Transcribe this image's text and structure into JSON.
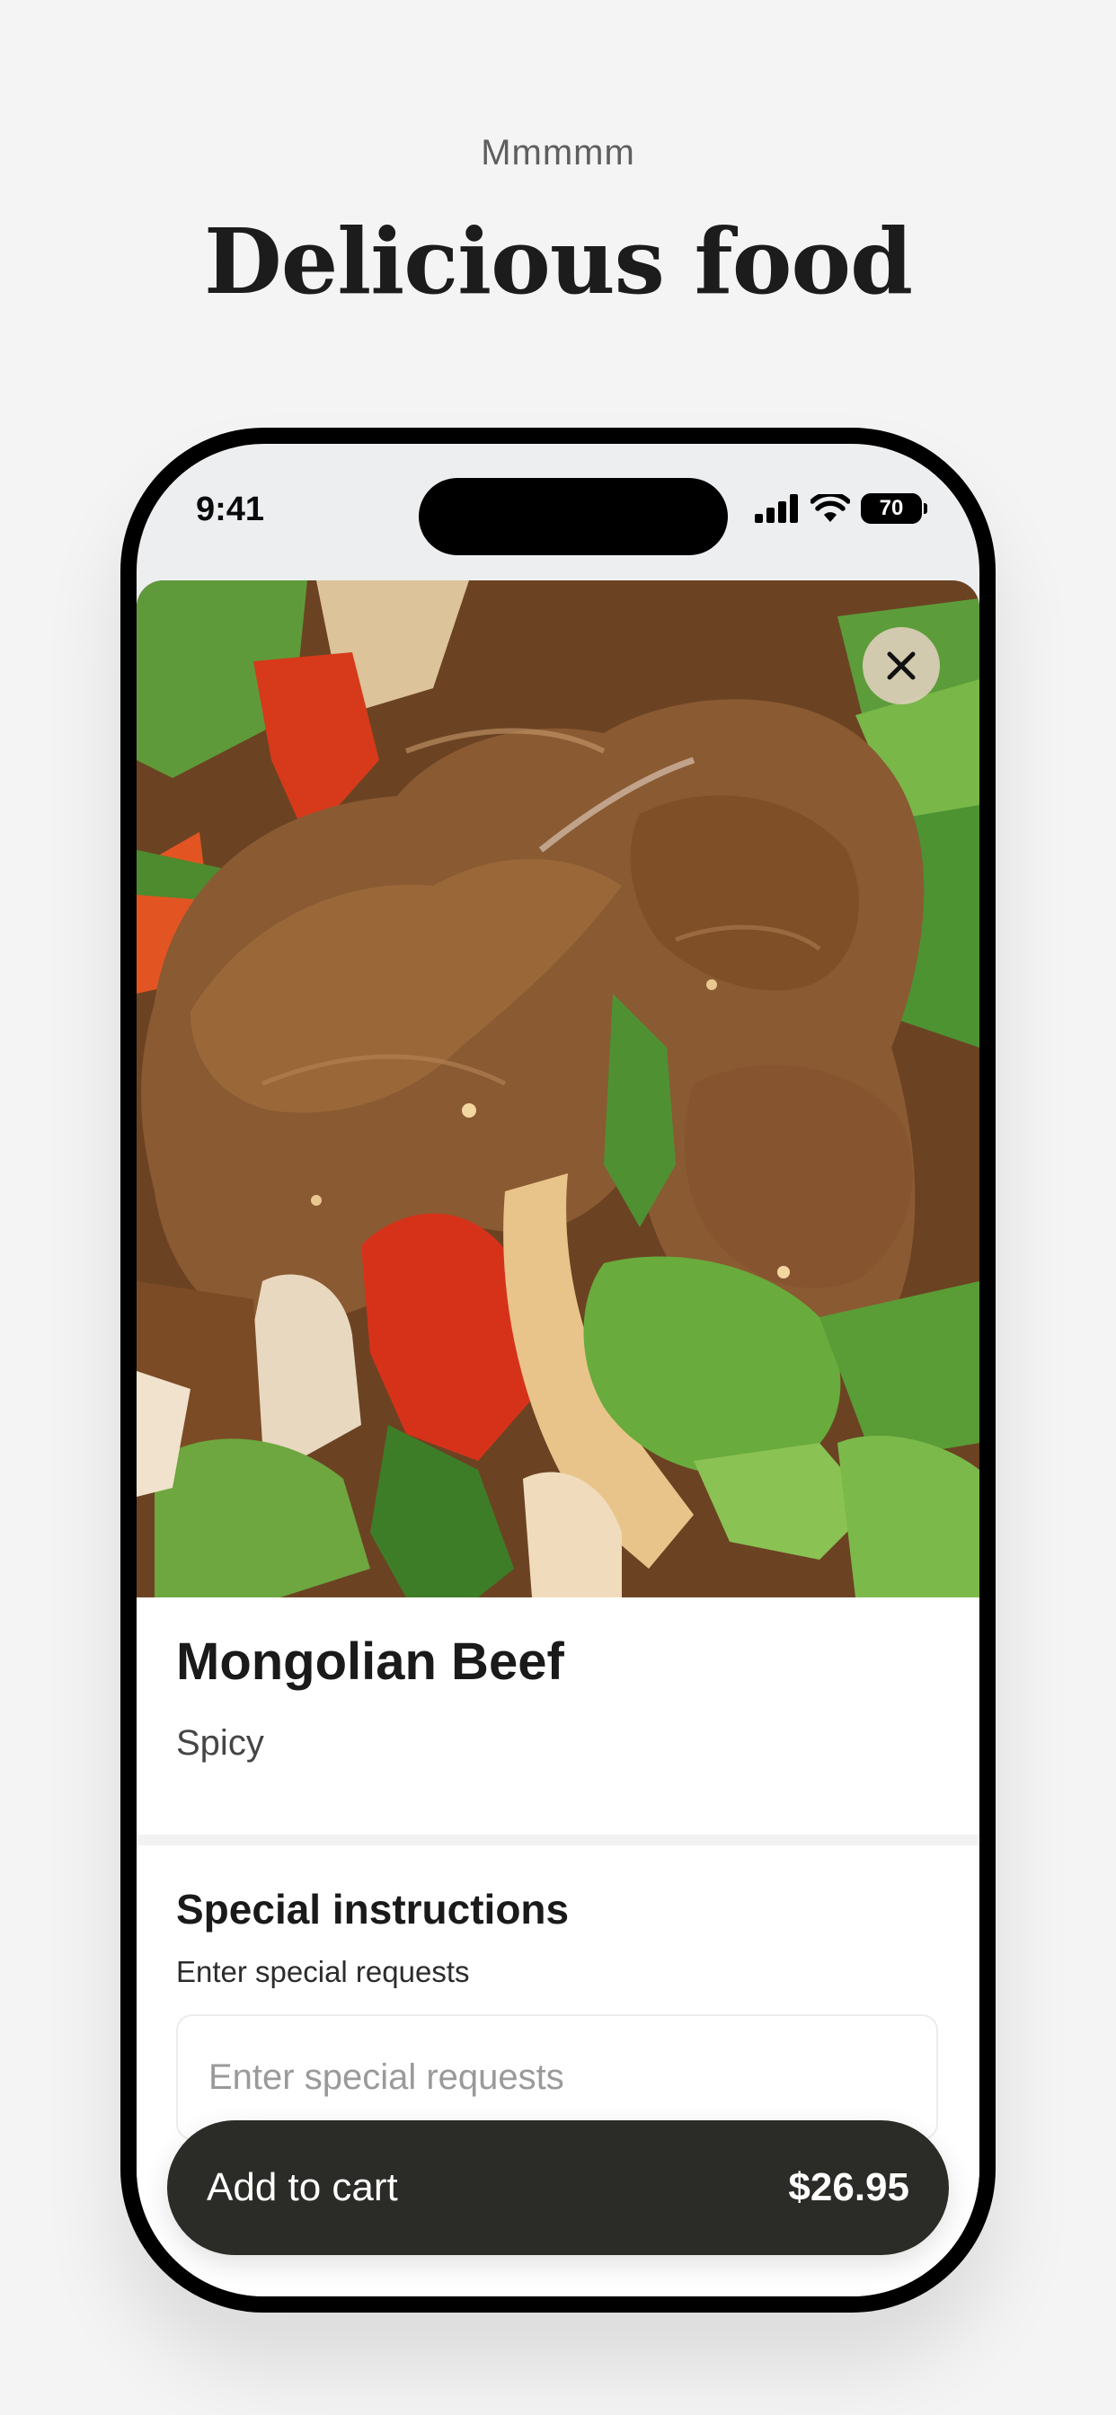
{
  "hero": {
    "kicker": "Mmmmm",
    "headline": "Delicious food"
  },
  "status_bar": {
    "time": "9:41",
    "battery": "70",
    "icons": [
      "cellular-signal-icon",
      "wifi-icon",
      "battery-icon"
    ]
  },
  "item": {
    "photo_subject": "Mongolian beef with peppers and onions",
    "close_icon": "close-icon",
    "name": "Mongolian Beef",
    "description": "Spicy"
  },
  "instructions": {
    "title": "Special instructions",
    "subtitle": "Enter special requests",
    "placeholder": "Enter special requests",
    "value": ""
  },
  "cart": {
    "label": "Add to cart",
    "price": "$26.95"
  },
  "colors": {
    "background": "#f4f4f4",
    "button": "#2b2b28",
    "text": "#1a1a1a"
  }
}
